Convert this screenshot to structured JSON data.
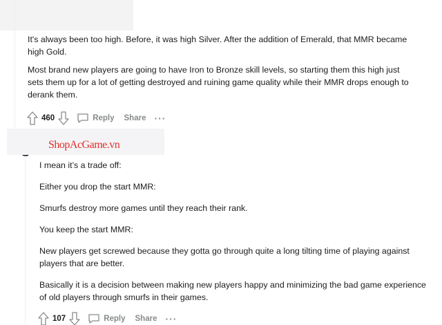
{
  "comment1": {
    "paragraphs": [
      "It's always been too high. Before, it was high Silver. After the addition of Emerald, that MMR became high Gold.",
      "Most brand new players are going to have Iron to Bronze skill levels, so starting them this high just sets them up for a lot of getting destroyed and ruining game quality while their MMR drops enough to derank them."
    ],
    "votes": "460",
    "reply_label": "Reply",
    "share_label": "Share",
    "more_label": "···"
  },
  "watermark": "ShopAcGame.vn",
  "comment2": {
    "paragraphs": [
      "I mean it’s a trade off:",
      "Either you drop the start MMR:",
      "Smurfs destroy more games until they reach their rank.",
      "You keep the start MMR:",
      "New players get screwed because they gotta go through quite a long tilting time of playing against players that are better.",
      "Basically it is a decision between making new players happy and minimizing the bad game experience of old players through smurfs in their games."
    ],
    "votes": "107",
    "reply_label": "Reply",
    "share_label": "Share",
    "more_label": "···"
  },
  "icons": [
    "upvote-icon",
    "downvote-icon",
    "comment-bubble-icon"
  ],
  "colors": {
    "muted": "#878a8c",
    "watermark": "#e0302a",
    "thread_line": "#edeff1"
  }
}
